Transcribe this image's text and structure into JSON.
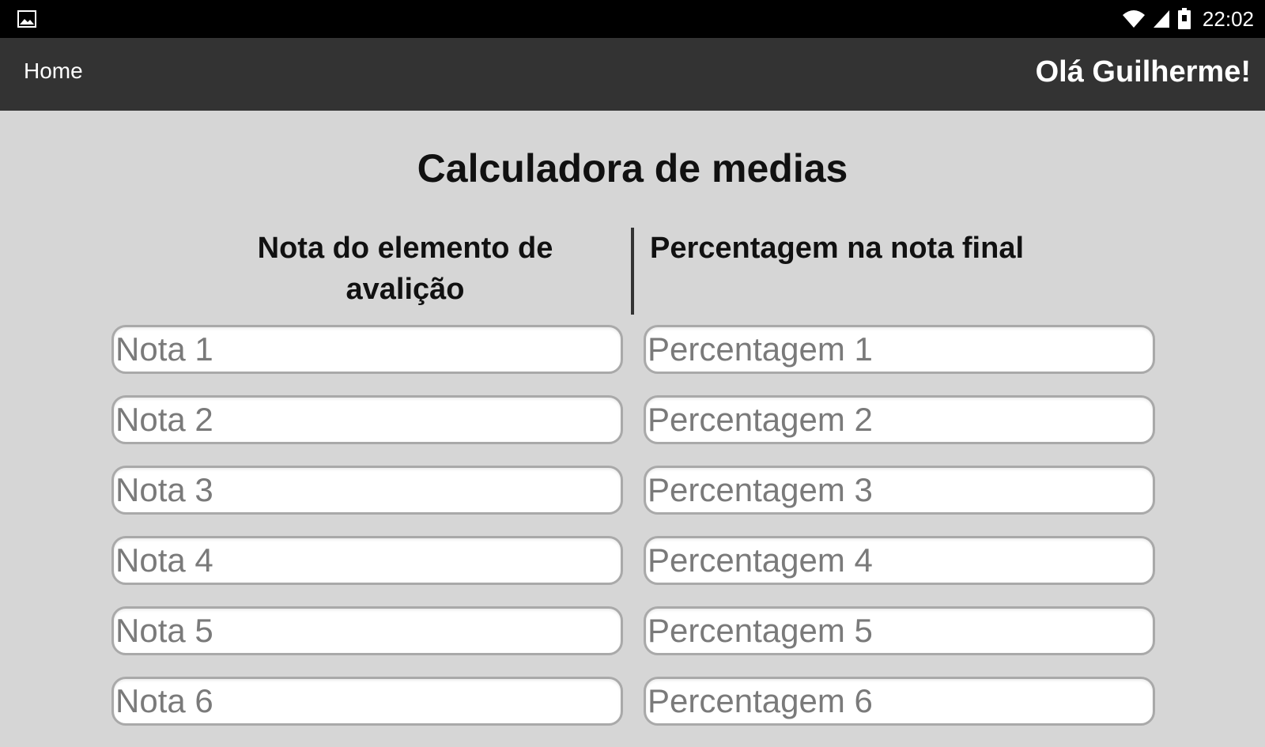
{
  "statusbar": {
    "left_icon": "image-icon",
    "icons": [
      "wifi-icon",
      "signal-icon",
      "battery-icon"
    ],
    "time": "22:02"
  },
  "appbar": {
    "home_label": "Home",
    "greeting": "Olá Guilherme!"
  },
  "main": {
    "title": "Calculadora de medias",
    "columns": {
      "left_header": "Nota do elemento de avalição",
      "right_header": "Percentagem na nota final"
    },
    "rows": [
      {
        "nota_placeholder": "Nota 1",
        "nota_value": "",
        "perc_placeholder": "Percentagem 1",
        "perc_value": ""
      },
      {
        "nota_placeholder": "Nota 2",
        "nota_value": "",
        "perc_placeholder": "Percentagem 2",
        "perc_value": ""
      },
      {
        "nota_placeholder": "Nota 3",
        "nota_value": "",
        "perc_placeholder": "Percentagem 3",
        "perc_value": ""
      },
      {
        "nota_placeholder": "Nota 4",
        "nota_value": "",
        "perc_placeholder": "Percentagem 4",
        "perc_value": ""
      },
      {
        "nota_placeholder": "Nota 5",
        "nota_value": "",
        "perc_placeholder": "Percentagem 5",
        "perc_value": ""
      },
      {
        "nota_placeholder": "Nota 6",
        "nota_value": "",
        "perc_placeholder": "Percentagem 6",
        "perc_value": ""
      }
    ]
  },
  "colors": {
    "statusbar_bg": "#000000",
    "appbar_bg": "#333333",
    "page_bg": "#d6d6d6",
    "field_bg": "#ffffff",
    "field_border": "#a9a9a9"
  }
}
